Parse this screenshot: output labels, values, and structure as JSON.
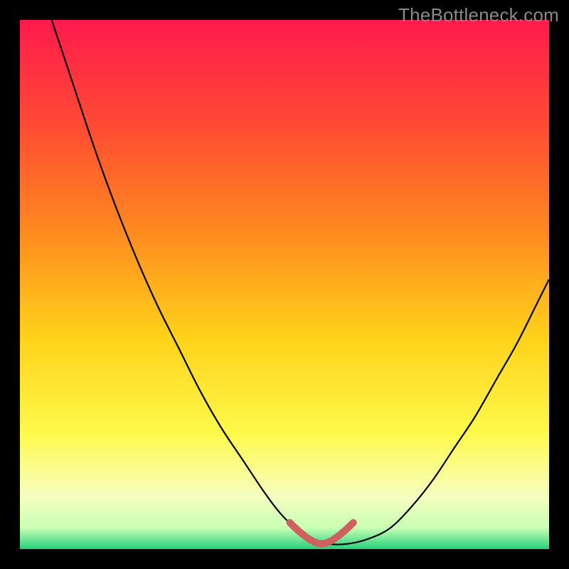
{
  "attribution": "TheBottleneck.com",
  "colors": {
    "background_outer": "#000000",
    "gradient_stops": [
      {
        "offset": 0.0,
        "color": "#ff1a4d"
      },
      {
        "offset": 0.2,
        "color": "#ff4b33"
      },
      {
        "offset": 0.4,
        "color": "#ff8a1f"
      },
      {
        "offset": 0.6,
        "color": "#ffd21a"
      },
      {
        "offset": 0.78,
        "color": "#fff94a"
      },
      {
        "offset": 0.9,
        "color": "#f6ffbf"
      },
      {
        "offset": 0.96,
        "color": "#c8ffb4"
      },
      {
        "offset": 1.0,
        "color": "#25d07c"
      }
    ],
    "curve": "#000000",
    "marker": "#cf6060"
  },
  "chart_data": {
    "type": "line",
    "title": "",
    "xlabel": "",
    "ylabel": "",
    "xlim": [
      0,
      100
    ],
    "ylim": [
      0,
      100
    ],
    "grid": false,
    "legend_position": "none",
    "series": [
      {
        "name": "bottleneck-curve",
        "x": [
          6,
          10,
          14,
          18,
          22,
          26,
          30,
          34,
          38,
          42,
          46,
          49,
          52,
          55,
          58,
          62,
          66,
          70,
          74,
          78,
          82,
          86,
          90,
          94,
          98,
          100
        ],
        "values": [
          100,
          88,
          76,
          65,
          55,
          46,
          38,
          30,
          23,
          17,
          11,
          7,
          4,
          2,
          1,
          1,
          2,
          4,
          8,
          13,
          19,
          25,
          32,
          39,
          47,
          51
        ]
      }
    ],
    "markers": [
      {
        "name": "optimal-band-start",
        "x": 51,
        "y": 3
      },
      {
        "name": "optimal-band-end",
        "x": 63,
        "y": 3
      }
    ],
    "notes": "y is bottleneck percentage (0 = no bottleneck near valley); x is relative component balance. Values estimated from pixel positions against the gradient background."
  }
}
